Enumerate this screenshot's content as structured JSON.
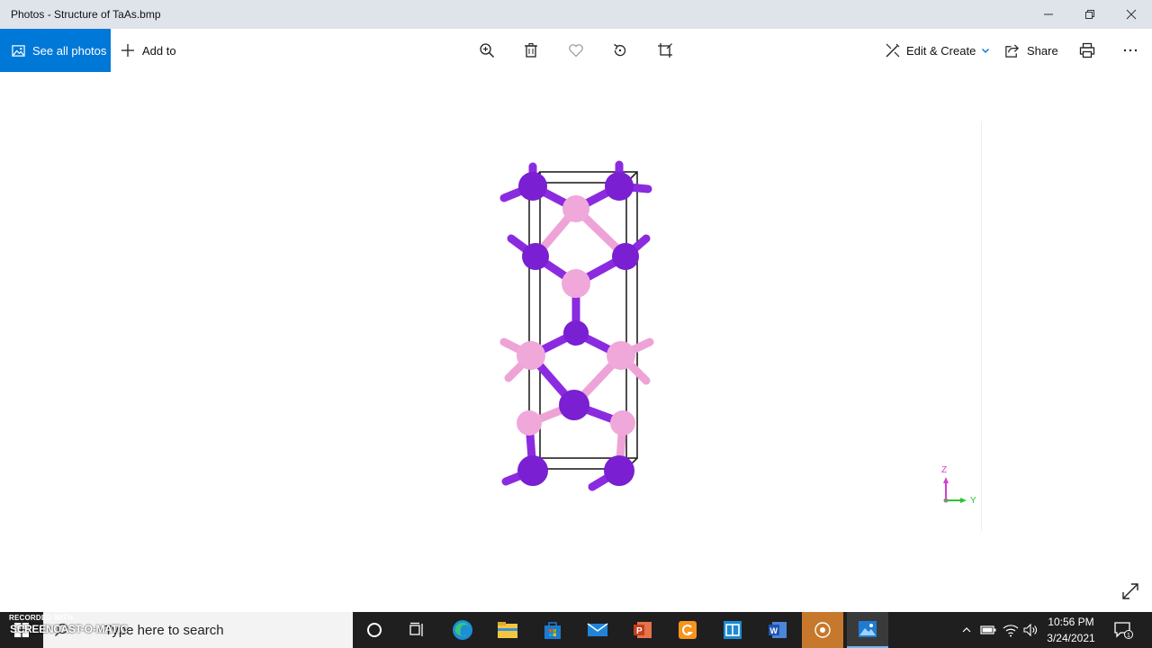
{
  "window": {
    "title": "Photos - Structure of TaAs.bmp",
    "controls": {
      "minimize": "minimize-icon",
      "restore": "restore-icon",
      "close": "close-icon"
    }
  },
  "toolbar": {
    "see_all_label": "See all photos",
    "add_to_label": "Add to",
    "center_icons": [
      "zoom-icon",
      "delete-icon",
      "favorite-icon",
      "rotate-icon",
      "crop-icon"
    ],
    "edit_create_label": "Edit & Create",
    "share_label": "Share",
    "print_icon": "print-icon",
    "more_icon": "more-icon",
    "accent_color": "#0078d7"
  },
  "image": {
    "content": "TaAs crystal structure",
    "atom_colors": {
      "ta": "#7a1fd1",
      "as": "#eea3d6"
    },
    "axes": {
      "z": "Z",
      "y": "Y"
    }
  },
  "taskbar": {
    "search_placeholder": "Type here to search",
    "recorded_with": "RECORDED WITH",
    "screencast_label": "SCREENCAST-O-MATIC",
    "apps": [
      "cortana-icon",
      "task-view-icon",
      "edge-icon",
      "file-explorer-icon",
      "store-icon",
      "mail-icon",
      "powerpoint-icon",
      "orange-app-icon",
      "blue-app-icon",
      "word-icon",
      "recorder-icon",
      "photos-icon"
    ],
    "time": "10:56 PM",
    "date": "3/24/2021",
    "notification_count": "1"
  }
}
